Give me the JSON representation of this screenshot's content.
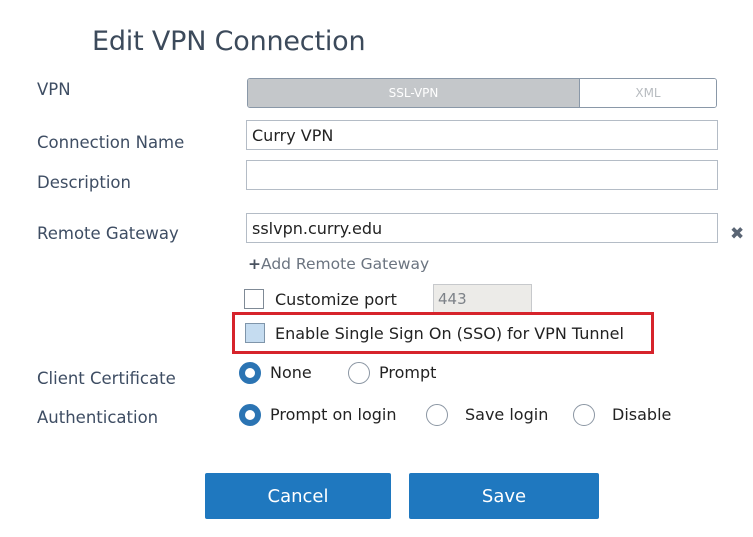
{
  "dialog": {
    "title": "Edit VPN Connection"
  },
  "fields": {
    "vpn_label": "VPN",
    "vpn_options": [
      "SSL-VPN",
      "XML"
    ],
    "vpn_selected": "SSL-VPN",
    "connection_name_label": "Connection Name",
    "connection_name_value": "Curry VPN",
    "description_label": "Description",
    "description_value": "",
    "remote_gateway_label": "Remote Gateway",
    "remote_gateway_value": "sslvpn.curry.edu",
    "add_remote_gateway": "Add Remote Gateway",
    "customize_port_label": "Customize port",
    "customize_port_checked": false,
    "port_value": "443",
    "sso_label": "Enable Single Sign On (SSO) for VPN Tunnel",
    "sso_checked": false,
    "client_certificate_label": "Client Certificate",
    "client_certificate_options": [
      "None",
      "Prompt"
    ],
    "client_certificate_selected": "None",
    "authentication_label": "Authentication",
    "authentication_options": [
      "Prompt on login",
      "Save login",
      "Disable"
    ],
    "authentication_selected": "Prompt on login"
  },
  "buttons": {
    "cancel": "Cancel",
    "save": "Save"
  },
  "colors": {
    "primary_button": "#1f78bf",
    "radio_selected": "#2b74b3",
    "highlight_border": "#d6232b",
    "label_text": "#3e4d63"
  }
}
